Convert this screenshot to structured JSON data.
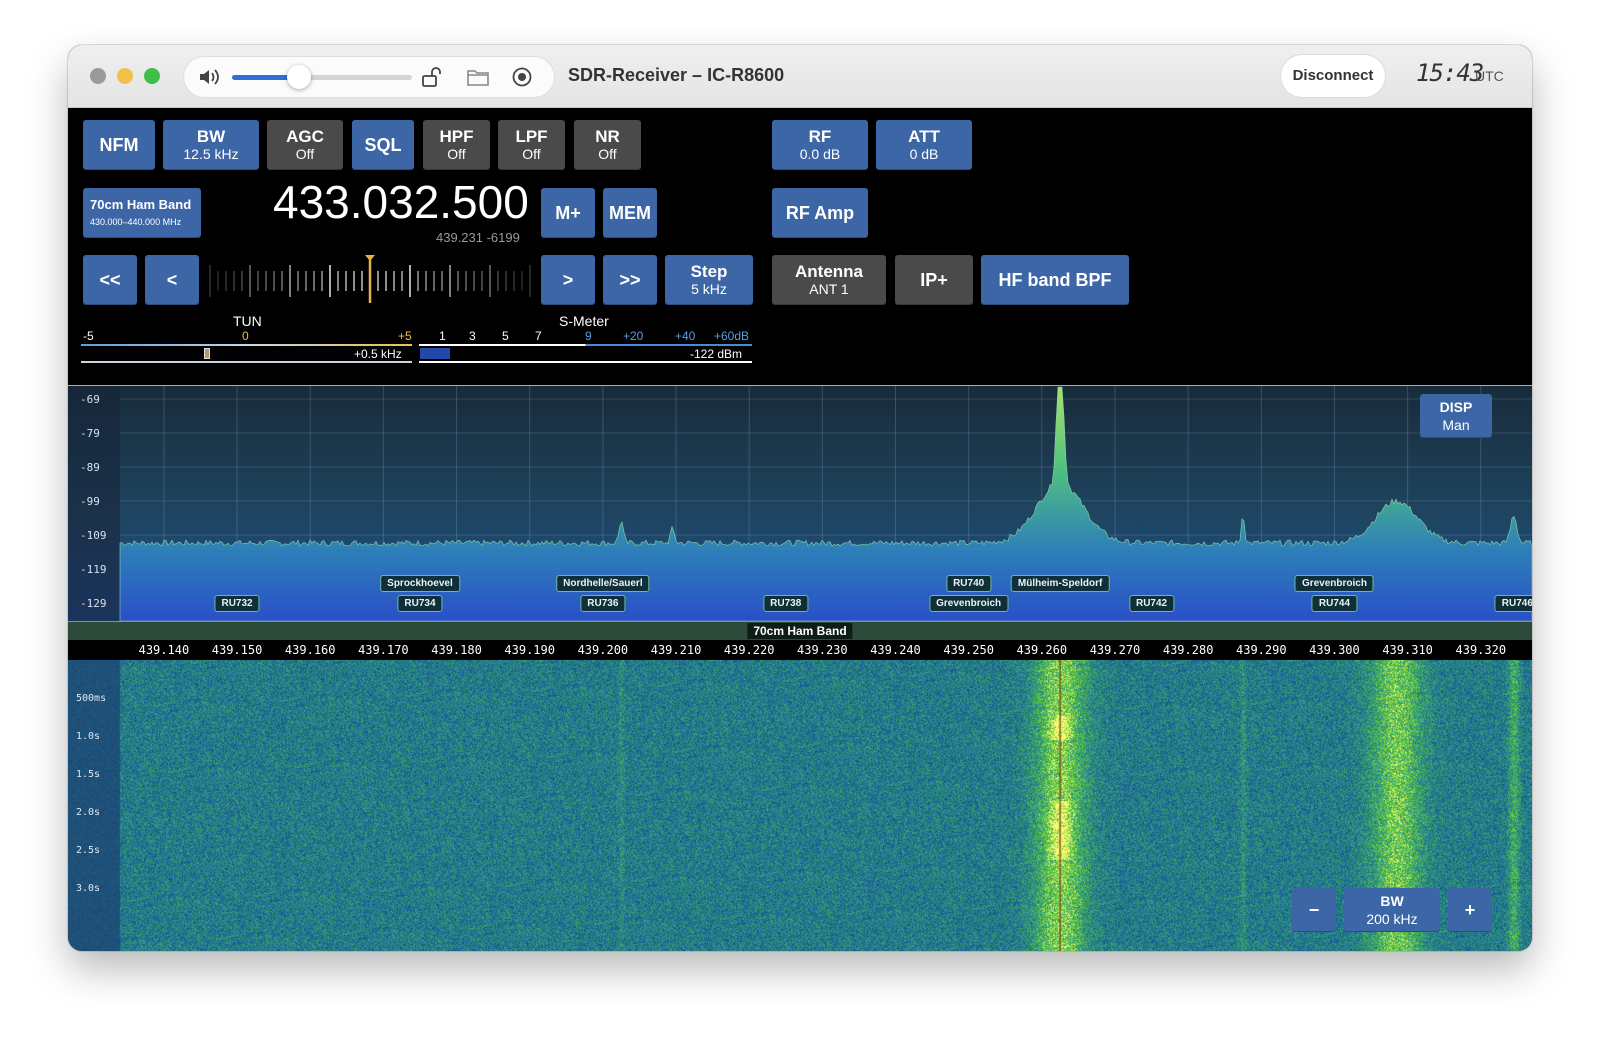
{
  "window": {
    "title": "SDR-Receiver – IC-R8600",
    "disconnect": "Disconnect",
    "clock": "15:43",
    "clock_zone": "UTC"
  },
  "volume": {
    "level": 0.37
  },
  "top_buttons": {
    "mode": "NFM",
    "bw_label": "BW",
    "bw_value": "12.5 kHz",
    "agc_label": "AGC",
    "agc_value": "Off",
    "sql": "SQL",
    "hpf_label": "HPF",
    "hpf_value": "Off",
    "lpf_label": "LPF",
    "lpf_value": "Off",
    "nr_label": "NR",
    "nr_value": "Off",
    "rf_label": "RF",
    "rf_value": "0.0 dB",
    "att_label": "ATT",
    "att_value": "0 dB"
  },
  "band": {
    "name": "70cm Ham Band",
    "range": "430.000–440.000 MHz"
  },
  "frequency": {
    "main": "433.032.500",
    "sub": "439.231 -6199"
  },
  "mem_buttons": {
    "mplus": "M+",
    "mem": "MEM",
    "rfamp": "RF Amp"
  },
  "tune_buttons": {
    "fast_down": "<<",
    "down": "<",
    "up": ">",
    "fast_up": ">>",
    "step_label": "Step",
    "step_value": "5 kHz"
  },
  "antenna": {
    "label": "Antenna",
    "value": "ANT 1",
    "ipplus": "IP+",
    "hfbpf": "HF band BPF"
  },
  "tun_meter": {
    "title": "TUN",
    "min": "-5",
    "mid": "0",
    "max": "+5",
    "readout": "+0.5 kHz",
    "offset": 0.05
  },
  "s_meter": {
    "title": "S-Meter",
    "ticks": [
      "1",
      "3",
      "5",
      "7",
      "9",
      "+20",
      "+40",
      "+60dB"
    ],
    "readout": "-122 dBm",
    "level": 0.09
  },
  "spectrum": {
    "disp_label": "DISP",
    "disp_value": "Man",
    "y_labels": [
      "-69",
      "-79",
      "-89",
      "-99",
      "-109",
      "-119",
      "-129"
    ],
    "channels_low": [
      {
        "name": "RU732",
        "f": 439.15
      },
      {
        "name": "RU734",
        "f": 439.175
      },
      {
        "name": "RU736",
        "f": 439.2
      },
      {
        "name": "RU738",
        "f": 439.225
      },
      {
        "name": "Grevenbroich",
        "f": 439.25
      },
      {
        "name": "RU742",
        "f": 439.275
      },
      {
        "name": "RU744",
        "f": 439.3
      },
      {
        "name": "RU746",
        "f": 439.325
      }
    ],
    "channels_high": [
      {
        "name": "Sprockhoevel",
        "f": 439.175
      },
      {
        "name": "Nordhelle/Sauerl",
        "f": 439.2
      },
      {
        "name": "RU740",
        "f": 439.25
      },
      {
        "name": "Mülheim-Speldorf",
        "f": 439.2625
      },
      {
        "name": "Grevenbroich",
        "f": 439.3
      }
    ],
    "band_label": "70cm Ham Band",
    "x_labels": [
      "439.140",
      "439.150",
      "439.160",
      "439.170",
      "439.180",
      "439.190",
      "439.200",
      "439.210",
      "439.220",
      "439.230",
      "439.240",
      "439.250",
      "439.260",
      "439.270",
      "439.280",
      "439.290",
      "439.300",
      "439.310",
      "439.320"
    ]
  },
  "waterfall": {
    "labels": [
      "500ms",
      "1.0s",
      "1.5s",
      "2.0s",
      "2.5s",
      "3.0s"
    ],
    "bw_label": "BW",
    "bw_value": "200 kHz",
    "minus": "−",
    "plus": "+"
  }
}
